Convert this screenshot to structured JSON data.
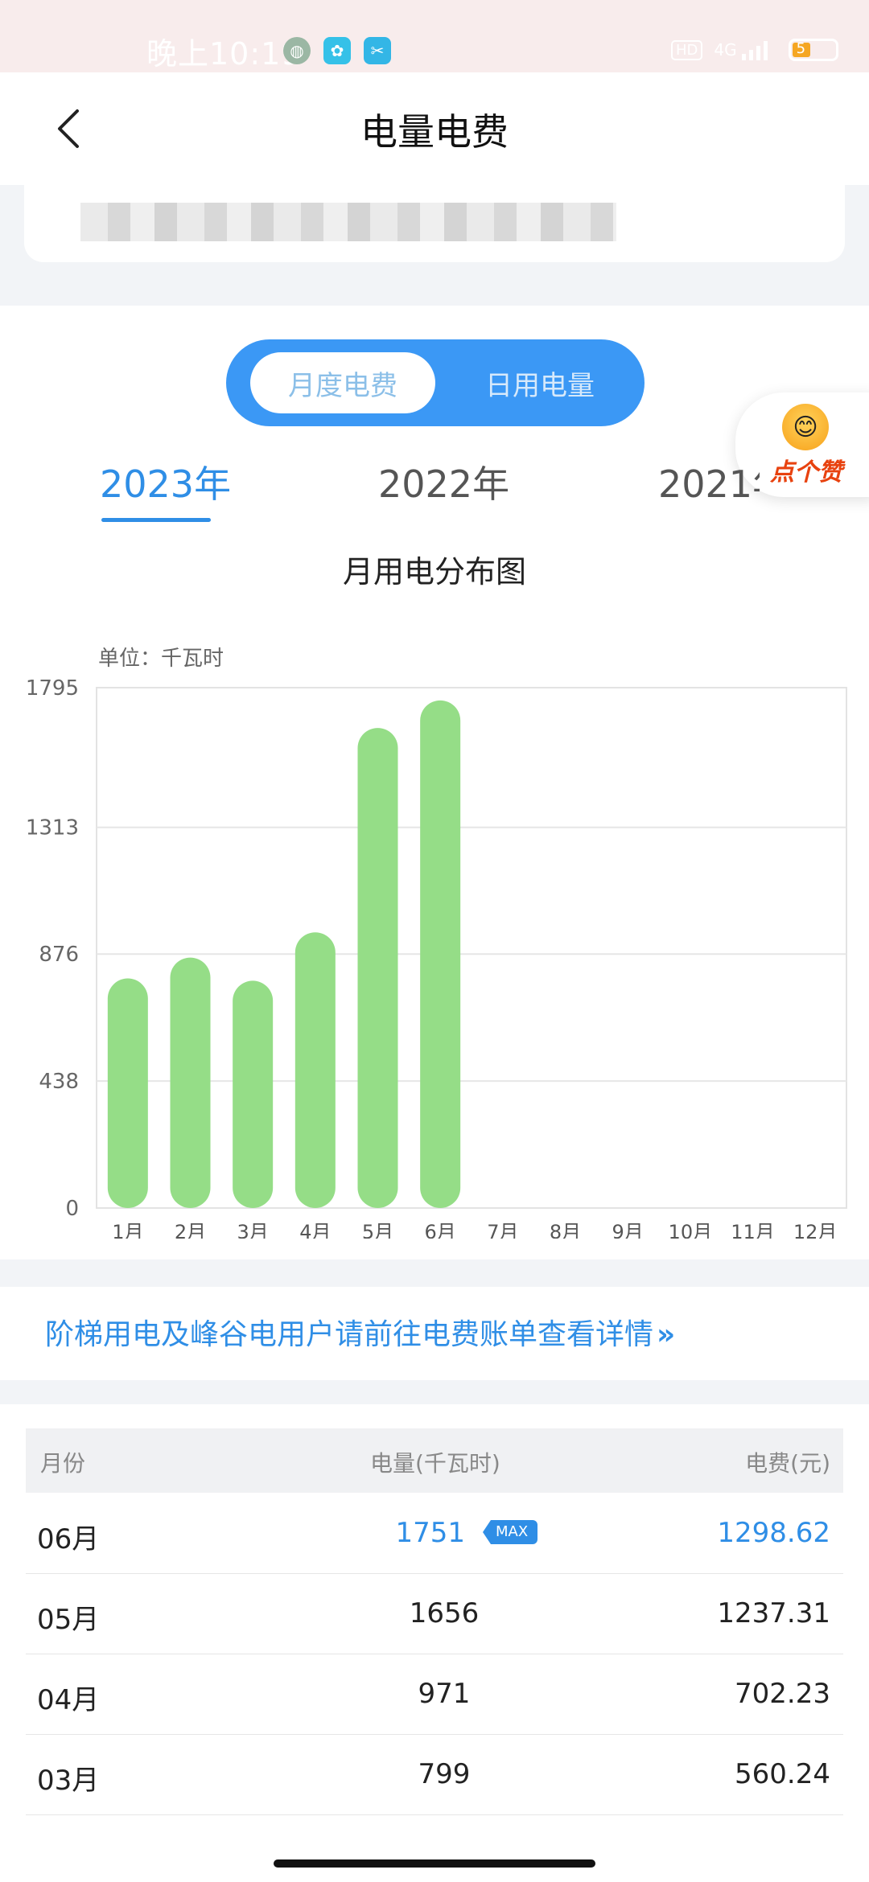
{
  "status_bar": {
    "time": "晚上10:19",
    "network": "4G",
    "battery": "5"
  },
  "header": {
    "title": "电量电费"
  },
  "tabs": {
    "segments": [
      "月度电费",
      "日用电量"
    ],
    "active_segment": "月度电费",
    "years": [
      "2023年",
      "2022年",
      "2021年"
    ],
    "active_year": "2023年"
  },
  "like_badge": {
    "label": "点个赞"
  },
  "chart": {
    "title": "月用电分布图",
    "unit_label": "单位：千瓦时"
  },
  "chart_data": {
    "type": "bar",
    "categories": [
      "1月",
      "2月",
      "3月",
      "4月",
      "5月",
      "6月",
      "7月",
      "8月",
      "9月",
      "10月",
      "11月",
      "12月"
    ],
    "values": [
      792,
      864,
      784,
      951,
      1656,
      1751,
      null,
      null,
      null,
      null,
      null,
      null
    ],
    "ylim": [
      0,
      1795
    ],
    "yticks": [
      0,
      438,
      876,
      1313,
      1795
    ],
    "bar_color": "#95dd87",
    "grid": true
  },
  "notice": {
    "text": "阶梯用电及峰谷电用户请前往电费账单查看详情",
    "chevron": "»"
  },
  "table": {
    "headers": [
      "月份",
      "电量(千瓦时)",
      "电费(元)"
    ],
    "max_badge": "MAX",
    "rows": [
      {
        "month": "06月",
        "kwh": "1751",
        "fee": "1298.62",
        "highlight": true
      },
      {
        "month": "05月",
        "kwh": "1656",
        "fee": "1237.31",
        "highlight": false
      },
      {
        "month": "04月",
        "kwh": "971",
        "fee": "702.23",
        "highlight": false
      },
      {
        "month": "03月",
        "kwh": "799",
        "fee": "560.24",
        "highlight": false
      }
    ]
  },
  "colors": {
    "accent": "#2f8ee6",
    "segment_bg": "#3b98f5",
    "bar": "#95dd87"
  }
}
